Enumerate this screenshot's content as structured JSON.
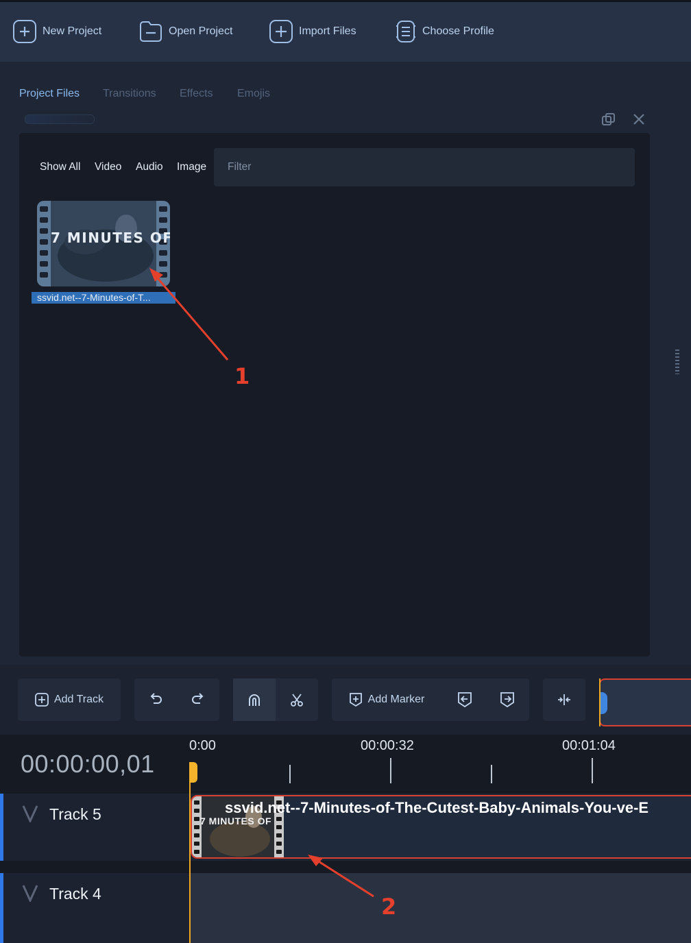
{
  "toolbar": {
    "new_project": "New Project",
    "open_project": "Open Project",
    "import_files": "Import Files",
    "choose_profile": "Choose Profile"
  },
  "tabs": [
    "Project Files",
    "Transitions",
    "Effects",
    "Emojis"
  ],
  "filters": [
    "Show All",
    "Video",
    "Audio",
    "Image"
  ],
  "filter_placeholder": "Filter",
  "file": {
    "thumb_text": "7 MINUTES OF",
    "name": "ssvid.net--7-Minutes-of-T..."
  },
  "annotations": [
    "1",
    "2"
  ],
  "timeline_toolbar": {
    "add_track": "Add Track",
    "add_marker": "Add Marker"
  },
  "timeline": {
    "timecode": "00:00:00,01",
    "ruler": [
      "0:00",
      "00:00:32",
      "00:01:04"
    ],
    "tracks": [
      "Track 5",
      "Track 4"
    ],
    "clip_title": "ssvid.net--7-Minutes-of-The-Cutest-Baby-Animals-You-ve-E",
    "clip_thumb_text": "7 MINUTES OF"
  },
  "colors": {
    "accent": "#2f7ae8",
    "playhead": "#f0a823",
    "annotation": "#e4402c"
  }
}
